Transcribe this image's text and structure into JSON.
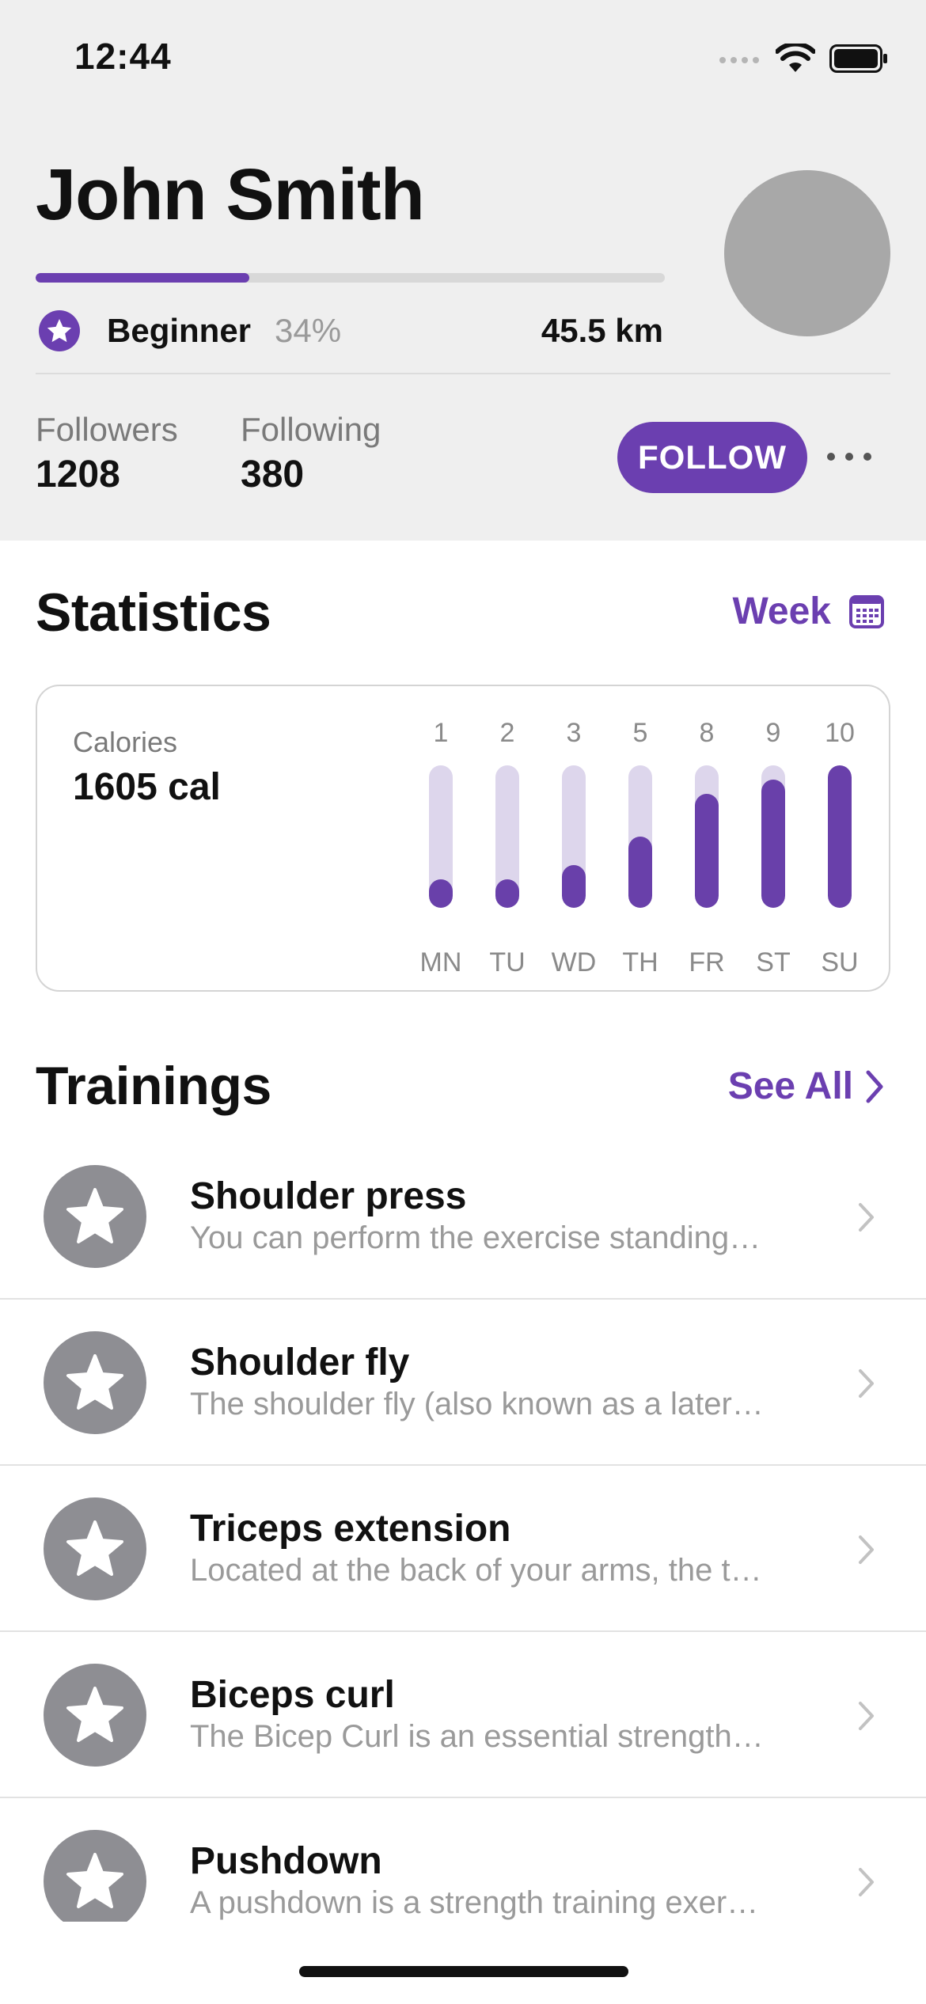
{
  "status_bar": {
    "time": "12:44"
  },
  "profile": {
    "name": "John Smith",
    "level": "Beginner",
    "level_progress_label": "34%",
    "level_progress": 0.34,
    "distance": "45.5 km",
    "followers_label": "Followers",
    "followers": "1208",
    "following_label": "Following",
    "following": "380",
    "follow_label": "FOLLOW"
  },
  "statistics": {
    "title": "Statistics",
    "period": "Week",
    "metric_label": "Calories",
    "metric_value": "1605 cal"
  },
  "chart_data": {
    "type": "bar",
    "categories": [
      "MN",
      "TU",
      "WD",
      "TH",
      "FR",
      "ST",
      "SU"
    ],
    "values": [
      1,
      2,
      3,
      5,
      8,
      9,
      10
    ],
    "ylim": [
      0,
      10
    ],
    "value_labels_position": "top",
    "colors": {
      "fill": "#6940aa",
      "track": "#ddd6ec"
    }
  },
  "trainings": {
    "title": "Trainings",
    "see_all": "See All",
    "items": [
      {
        "title": "Shoulder press",
        "description": "You can perform the exercise standing…"
      },
      {
        "title": "Shoulder fly",
        "description": "The shoulder fly (also known as a later…"
      },
      {
        "title": "Triceps extension",
        "description": "Located at the back of your arms, the t…"
      },
      {
        "title": "Biceps curl",
        "description": "The Bicep Curl is an essential strength…"
      },
      {
        "title": "Pushdown",
        "description": "A pushdown is a strength training exer…"
      }
    ]
  },
  "icons": {
    "level": "star-icon",
    "training": "star-icon",
    "calendar": "calendar-icon",
    "chevron": "chevron-right-icon"
  },
  "colors": {
    "accent": "#6b3fb0",
    "header_bg": "#efefef",
    "avatar_placeholder": "#a8a8a8",
    "training_icon_bg": "#8e8e93"
  }
}
